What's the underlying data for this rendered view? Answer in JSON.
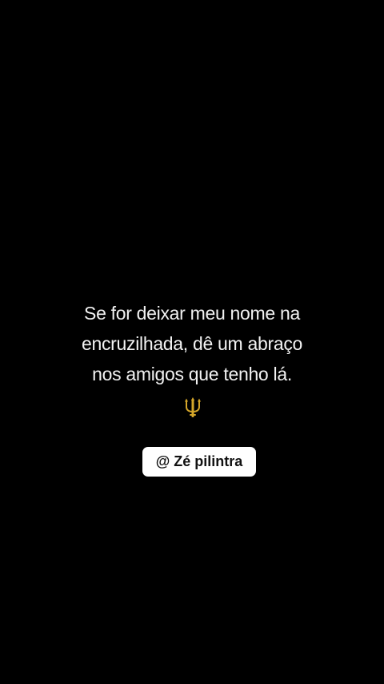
{
  "story": {
    "quote_lines": [
      "Se for deixar meu nome na",
      "encruzilhada, dê um abraço",
      "nos amigos que tenho lá."
    ],
    "emoji": "trident-icon",
    "mention": "@ Zé pilintra"
  },
  "colors": {
    "background": "#000000",
    "text": "#f2f2f2",
    "trident": "#d4a62a",
    "mention_bg": "#ffffff",
    "mention_text": "#111111"
  }
}
